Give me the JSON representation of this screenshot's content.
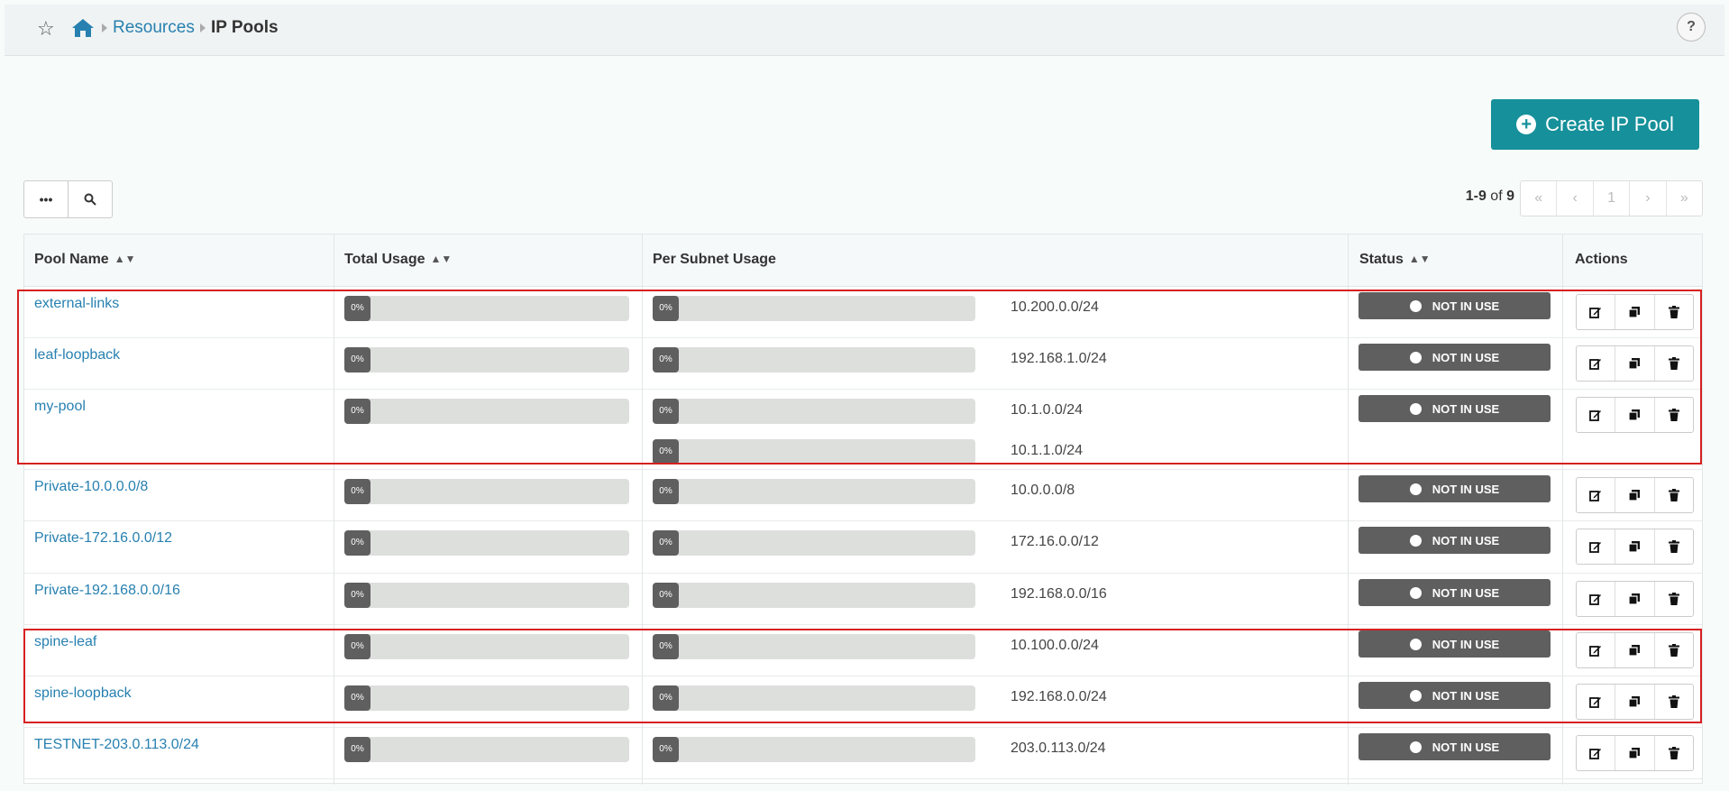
{
  "breadcrumb": {
    "items": [
      "Resources"
    ],
    "current": "IP Pools"
  },
  "help_label": "?",
  "create_button_label": "Create IP Pool",
  "toolbar": {
    "more_label": "•••"
  },
  "pagination": {
    "range": "1-9",
    "of": "of",
    "total": "9",
    "first": "«",
    "prev": "‹",
    "page": "1",
    "next": "›",
    "last": "»"
  },
  "columns": {
    "pool_name": "Pool Name",
    "total_usage": "Total Usage",
    "per_subnet_usage": "Per Subnet Usage",
    "status": "Status",
    "actions": "Actions"
  },
  "rows": [
    {
      "name": "external-links",
      "total": "0%",
      "subnets": [
        {
          "pct": "0%",
          "cidr": "10.200.0.0/24"
        }
      ],
      "status": "NOT IN USE"
    },
    {
      "name": "leaf-loopback",
      "total": "0%",
      "subnets": [
        {
          "pct": "0%",
          "cidr": "192.168.1.0/24"
        }
      ],
      "status": "NOT IN USE"
    },
    {
      "name": "my-pool",
      "total": "0%",
      "subnets": [
        {
          "pct": "0%",
          "cidr": "10.1.0.0/24"
        },
        {
          "pct": "0%",
          "cidr": "10.1.1.0/24"
        }
      ],
      "status": "NOT IN USE"
    },
    {
      "name": "Private-10.0.0.0/8",
      "total": "0%",
      "subnets": [
        {
          "pct": "0%",
          "cidr": "10.0.0.0/8"
        }
      ],
      "status": "NOT IN USE"
    },
    {
      "name": "Private-172.16.0.0/12",
      "total": "0%",
      "subnets": [
        {
          "pct": "0%",
          "cidr": "172.16.0.0/12"
        }
      ],
      "status": "NOT IN USE"
    },
    {
      "name": "Private-192.168.0.0/16",
      "total": "0%",
      "subnets": [
        {
          "pct": "0%",
          "cidr": "192.168.0.0/16"
        }
      ],
      "status": "NOT IN USE"
    },
    {
      "name": "spine-leaf",
      "total": "0%",
      "subnets": [
        {
          "pct": "0%",
          "cidr": "10.100.0.0/24"
        }
      ],
      "status": "NOT IN USE"
    },
    {
      "name": "spine-loopback",
      "total": "0%",
      "subnets": [
        {
          "pct": "0%",
          "cidr": "192.168.0.0/24"
        }
      ],
      "status": "NOT IN USE"
    },
    {
      "name": "TESTNET-203.0.113.0/24",
      "total": "0%",
      "subnets": [
        {
          "pct": "0%",
          "cidr": "203.0.113.0/24"
        }
      ],
      "status": "NOT IN USE"
    }
  ],
  "colors": {
    "link": "#2780b0",
    "accent": "#16909a",
    "status_bg": "#5f5f5f",
    "highlight": "#d62020"
  }
}
